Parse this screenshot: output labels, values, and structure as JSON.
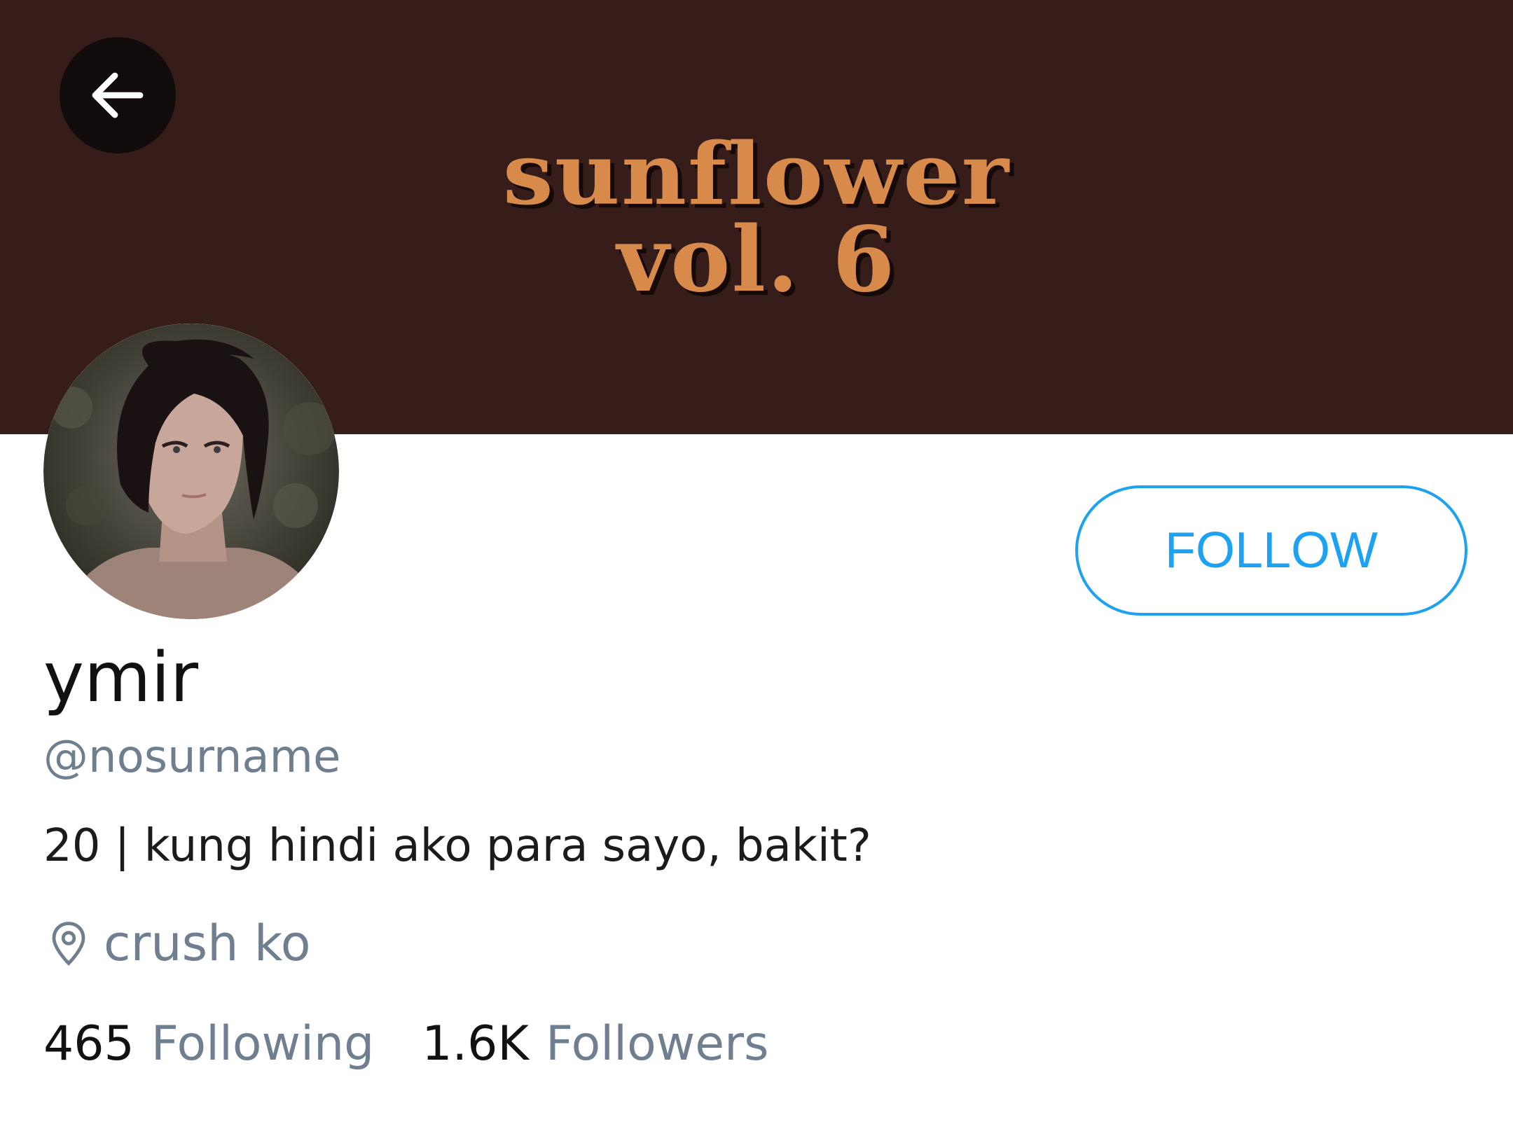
{
  "header": {
    "back_icon": "arrow-left-icon",
    "banner_title_line1": "sunflower",
    "banner_title_line2": "vol. 6",
    "banner_color": "#371d1a",
    "banner_text_color": "#d78a4a"
  },
  "profile": {
    "avatar_icon": "profile-avatar",
    "display_name": "ymir",
    "handle": "@nosurname",
    "bio": "20 | kung hindi ako para sayo, bakit?",
    "location_icon": "location-pin-icon",
    "location": "crush ko"
  },
  "actions": {
    "follow_label": "FOLLOW",
    "accent_color": "#1da1f2"
  },
  "stats": {
    "following_count": "465",
    "following_label": "Following",
    "followers_count": "1.6K",
    "followers_label": "Followers"
  }
}
